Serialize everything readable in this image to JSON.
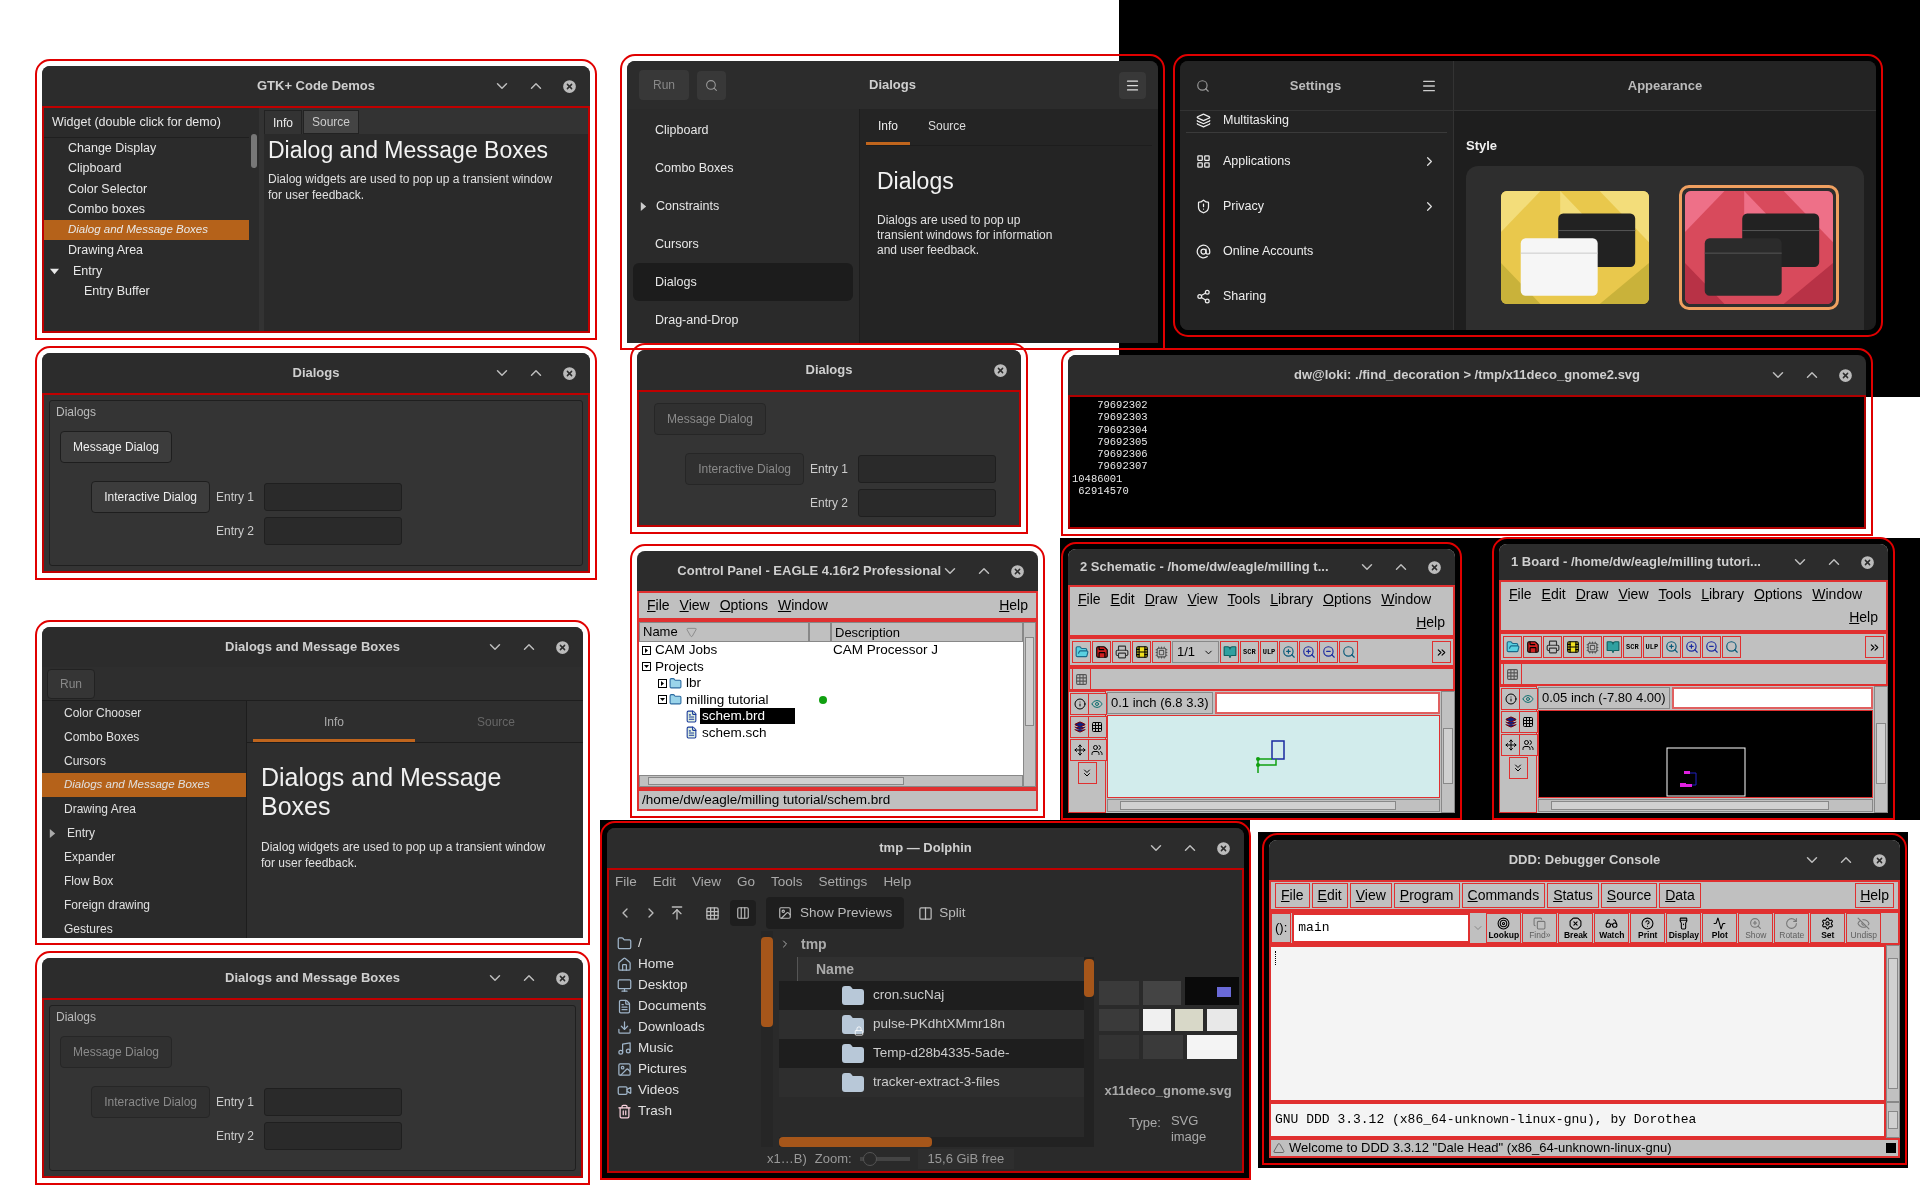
{
  "windows": [
    {
      "kind": "gtk2_demo",
      "title": "GTK+ Code Demos",
      "list_header": "Widget (double click for demo)",
      "items": [
        {
          "label": "Change Display",
          "selected": false
        },
        {
          "label": "Clipboard",
          "selected": false
        },
        {
          "label": "Color Selector",
          "selected": false
        },
        {
          "label": "Combo boxes",
          "selected": false
        },
        {
          "label": "Dialog and Message Boxes",
          "selected": true
        },
        {
          "label": "Drawing Area",
          "selected": false
        },
        {
          "label": "Entry",
          "selected": false,
          "expanded": true,
          "children": [
            {
              "label": "Entry Buffer",
              "selected": false
            }
          ]
        }
      ],
      "tabs": [
        {
          "label": "Info",
          "selected": true
        },
        {
          "label": "Source",
          "selected": false
        }
      ],
      "heading": "Dialog and Message Boxes",
      "body": "Dialog widgets are used to pop up a transient window for user feedback."
    },
    {
      "kind": "gtk4_demo",
      "title": "Dialogs",
      "run": "Run",
      "items": [
        {
          "label": "Clipboard",
          "selected": false
        },
        {
          "label": "Combo Boxes",
          "selected": false
        },
        {
          "label": "Constraints",
          "selected": false,
          "expanded": false
        },
        {
          "label": "Cursors",
          "selected": false
        },
        {
          "label": "Dialogs",
          "selected": true
        },
        {
          "label": "Drag-and-Drop",
          "selected": false
        }
      ],
      "tabs": [
        {
          "label": "Info",
          "selected": true
        },
        {
          "label": "Source",
          "selected": false
        }
      ],
      "heading": "Dialogs",
      "body": "Dialogs are used to pop up transient windows for information and user feedback."
    },
    {
      "kind": "settings",
      "title": "Settings",
      "page_title": "Appearance",
      "items": [
        {
          "label": "Multitasking",
          "arrow": false
        },
        {
          "label": "Applications",
          "arrow": true
        },
        {
          "label": "Privacy",
          "arrow": true
        },
        {
          "label": "Online Accounts",
          "arrow": false
        },
        {
          "label": "Sharing",
          "arrow": false
        }
      ],
      "section": "Style",
      "themes": [
        {
          "kind": "light",
          "selected": false
        },
        {
          "kind": "dark",
          "selected": true
        }
      ]
    },
    {
      "kind": "dialogs",
      "title": "Dialogs",
      "resizable": true,
      "frame_label": "Dialogs",
      "buttons": [
        {
          "label": "Message Dialog",
          "disabled": false
        },
        {
          "label": "Interactive Dialog",
          "disabled": false
        }
      ],
      "entries": [
        {
          "label": "Entry 1"
        },
        {
          "label": "Entry 2"
        }
      ]
    },
    {
      "kind": "dialogs",
      "title": "Dialogs",
      "resizable": false,
      "buttons": [
        {
          "label": "Message Dialog",
          "disabled": true
        },
        {
          "label": "Interactive Dialog",
          "disabled": true
        }
      ],
      "entries": [
        {
          "label": "Entry 1"
        },
        {
          "label": "Entry 2"
        }
      ]
    },
    {
      "kind": "terminal",
      "title": "dw@loki: ./find_decoration > /tmp/x11deco_gnome2.svg",
      "lines": [
        "    79692302",
        "    79692303",
        "    79692304",
        "    79692305",
        "    79692306",
        "    79692307",
        "10486001",
        " 62914570"
      ]
    },
    {
      "kind": "gtk3_demo",
      "title": "Dialogs and Message Boxes",
      "run": "Run",
      "items": [
        {
          "label": "Color Chooser",
          "selected": false
        },
        {
          "label": "Combo Boxes",
          "selected": false
        },
        {
          "label": "Cursors",
          "selected": false
        },
        {
          "label": "Dialogs and Message Boxes",
          "selected": true
        },
        {
          "label": "Drawing Area",
          "selected": false
        },
        {
          "label": "Entry",
          "selected": false,
          "expanded": false
        },
        {
          "label": "Expander",
          "selected": false
        },
        {
          "label": "Flow Box",
          "selected": false
        },
        {
          "label": "Foreign drawing",
          "selected": false
        },
        {
          "label": "Gestures",
          "selected": false
        }
      ],
      "tabs": [
        {
          "label": "Info",
          "selected": true
        },
        {
          "label": "Source",
          "selected": false
        }
      ],
      "heading": "Dialogs and Message Boxes",
      "body": "Dialog widgets are used to pop up a transient window for user feedback."
    },
    {
      "kind": "eagle_panel",
      "title": "Control Panel - EAGLE 4.16r2 Professional",
      "menus": [
        "File",
        "View",
        "Options",
        "Window"
      ],
      "help": "Help",
      "columns": [
        "Name",
        "Description"
      ],
      "tree": [
        {
          "label": "CAM Jobs",
          "description": "CAM Processor J",
          "expanded": false,
          "selected": false
        },
        {
          "label": "Projects",
          "expanded": true,
          "selected": false,
          "children": [
            {
              "label": "lbr",
              "expanded": false,
              "selected": false
            },
            {
              "label": "milling tutorial",
              "expanded": true,
              "selected": false,
              "color": "#10a010",
              "children": [
                {
                  "label": "schem.brd",
                  "selected": true
                },
                {
                  "label": "schem.sch",
                  "selected": false
                }
              ]
            }
          ]
        }
      ],
      "path": "/home/dw/eagle/milling tutorial/schem.brd"
    },
    {
      "kind": "eagle_editor",
      "canvas": {
        "kind": "schematic"
      },
      "title": "2 Schematic - /home/dw/eagle/milling t...",
      "menus": [
        "File",
        "Edit",
        "Draw",
        "View",
        "Tools",
        "Library",
        "Options",
        "Window"
      ],
      "help": "Help",
      "page": "1/1",
      "tool_labels": [
        "SCR",
        "ULP"
      ],
      "coords": "0.1 inch (6.8 3.3)"
    },
    {
      "kind": "eagle_editor",
      "canvas": {
        "kind": "board"
      },
      "title": "1 Board - /home/dw/eagle/milling tutori...",
      "menus": [
        "File",
        "Edit",
        "Draw",
        "View",
        "Tools",
        "Library",
        "Options",
        "Window"
      ],
      "help": "Help",
      "tool_labels": [
        "SCR",
        "ULP"
      ],
      "coords": "0.05 inch (-7.80 4.00)"
    },
    {
      "kind": "dialogs",
      "title": "Dialogs and Message Boxes",
      "resizable": true,
      "frame_label": "Dialogs",
      "buttons": [
        {
          "label": "Message Dialog",
          "disabled": true
        },
        {
          "label": "Interactive Dialog",
          "disabled": true
        }
      ],
      "entries": [
        {
          "label": "Entry 1"
        },
        {
          "label": "Entry 2"
        }
      ]
    },
    {
      "kind": "dolphin",
      "title": "tmp — Dolphin",
      "menus": [
        "File",
        "Edit",
        "View",
        "Go",
        "Tools",
        "Settings",
        "Help"
      ],
      "previews": "Show Previews",
      "split": "Split",
      "places": [
        "/",
        "Home",
        "Desktop",
        "Documents",
        "Downloads",
        "Music",
        "Pictures",
        "Videos",
        "Trash"
      ],
      "crumb": "tmp",
      "column": "Name",
      "files": [
        {
          "name": "cron.sucNaj",
          "locked": false
        },
        {
          "name": "pulse-PKdhtXMmr18n",
          "locked": true
        },
        {
          "name": "Temp-d28b4335-5ade-",
          "locked": false
        },
        {
          "name": "tracker-extract-3-files",
          "locked": false
        }
      ],
      "preview_name": "x11deco_gnome.svg",
      "type_label": "Type:",
      "type_value": "SVG image",
      "status": "x1…B)",
      "zoom": "Zoom:",
      "zoom_slider": {
        "level": 0.1
      },
      "free": "15,6 GiB free"
    },
    {
      "kind": "ddd",
      "title": "DDD: Debugger Console",
      "menus": [
        "File",
        "Edit",
        "View",
        "Program",
        "Commands",
        "Status",
        "Source",
        "Data"
      ],
      "help": "Help",
      "arg_label": "():",
      "arg": "main",
      "tools": [
        {
          "label": "Lookup",
          "disabled": false
        },
        {
          "label": "Find»",
          "disabled": true
        },
        {
          "label": "Break",
          "disabled": false
        },
        {
          "label": "Watch",
          "disabled": false
        },
        {
          "label": "Print",
          "disabled": false
        },
        {
          "label": "Display",
          "disabled": false
        },
        {
          "label": "Plot",
          "disabled": false
        },
        {
          "label": "Show",
          "disabled": true
        },
        {
          "label": "Rotate",
          "disabled": true
        },
        {
          "label": "Set",
          "disabled": false
        },
        {
          "label": "Undisp",
          "disabled": true
        }
      ],
      "console": "GNU DDD 3.3.12 (x86_64-unknown-linux-gnu), by Dorothea",
      "status": "Welcome to DDD 3.3.12 \"Dale Head\" (x86_64-unknown-linux-gnu)"
    }
  ]
}
